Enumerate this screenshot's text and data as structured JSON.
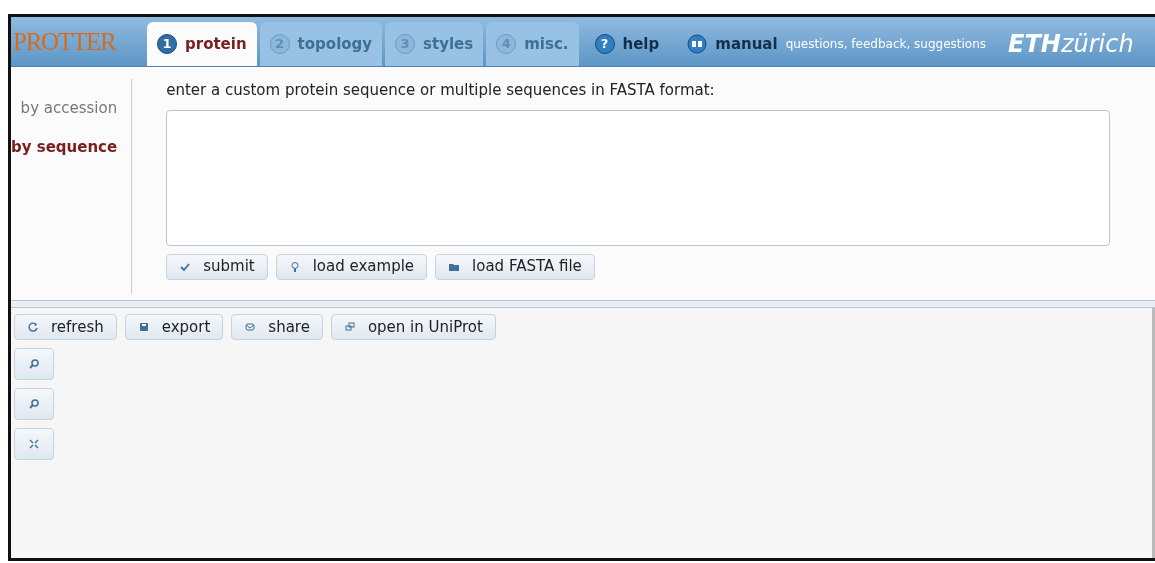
{
  "logo": "PROTTER",
  "tabs": [
    {
      "number": "1",
      "label": "protein",
      "selected": true
    },
    {
      "number": "2",
      "label": "topology",
      "selected": false
    },
    {
      "number": "3",
      "label": "styles",
      "selected": false
    },
    {
      "number": "4",
      "label": "misc.",
      "selected": false
    }
  ],
  "help": {
    "icon": "?",
    "label": "help"
  },
  "manual": {
    "label": "manual"
  },
  "feedback_link": "questions, feedback, suggestions",
  "brand": {
    "bold": "ETH",
    "rest": "zürich"
  },
  "side_nav": [
    {
      "label": "by accession",
      "selected": false
    },
    {
      "label": "by sequence",
      "selected": true
    }
  ],
  "sequence_prompt": "enter a custom protein sequence or multiple sequences in FASTA format:",
  "sequence_buttons": [
    {
      "kind": "check",
      "label": "submit"
    },
    {
      "kind": "bulb",
      "label": "load example"
    },
    {
      "kind": "folder",
      "label": "load FASTA file"
    }
  ],
  "toolbar_buttons": [
    {
      "kind": "refresh",
      "label": "refresh"
    },
    {
      "kind": "save",
      "label": "export"
    },
    {
      "kind": "mail",
      "label": "share"
    },
    {
      "kind": "link",
      "label": "open in UniProt"
    }
  ],
  "zoom_buttons": [
    {
      "kind": "zoom-in"
    },
    {
      "kind": "zoom-out"
    },
    {
      "kind": "fit"
    }
  ]
}
